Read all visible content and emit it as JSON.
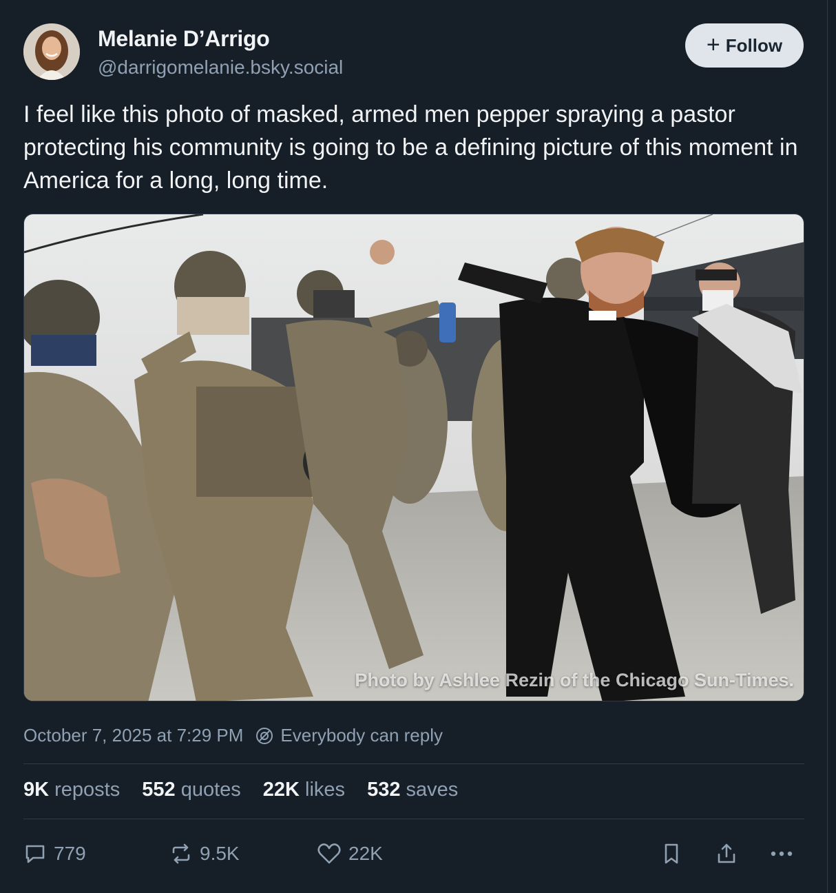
{
  "author": {
    "name": "Melanie D’Arrigo",
    "handle": "@darrigomelanie.bsky.social"
  },
  "follow_button": {
    "label": "Follow",
    "icon": "plus-icon"
  },
  "post": {
    "text": "I feel like this photo of masked, armed men pepper spraying a pastor protecting his community is going to be a defining picture of this moment in America for a long, long time.",
    "image_credit": "Photo by Ashlee Rezin of the Chicago Sun-Times.",
    "timestamp": "October 7, 2025 at 7:29 PM",
    "reply_setting": "Everybody can reply"
  },
  "stats": {
    "reposts": {
      "num": "9K",
      "label": "reposts"
    },
    "quotes": {
      "num": "552",
      "label": "quotes"
    },
    "likes": {
      "num": "22K",
      "label": "likes"
    },
    "saves": {
      "num": "532",
      "label": "saves"
    }
  },
  "actions": {
    "replies": "779",
    "reposts": "9.5K",
    "likes": "22K",
    "icons": [
      "reply-icon",
      "repost-icon",
      "heart-icon",
      "bookmark-icon",
      "share-icon",
      "more-icon"
    ]
  },
  "colors": {
    "background": "#161e27",
    "text": "#f1f3f5",
    "muted": "#8fa1b3",
    "follow_bg": "#dfe5ea"
  }
}
